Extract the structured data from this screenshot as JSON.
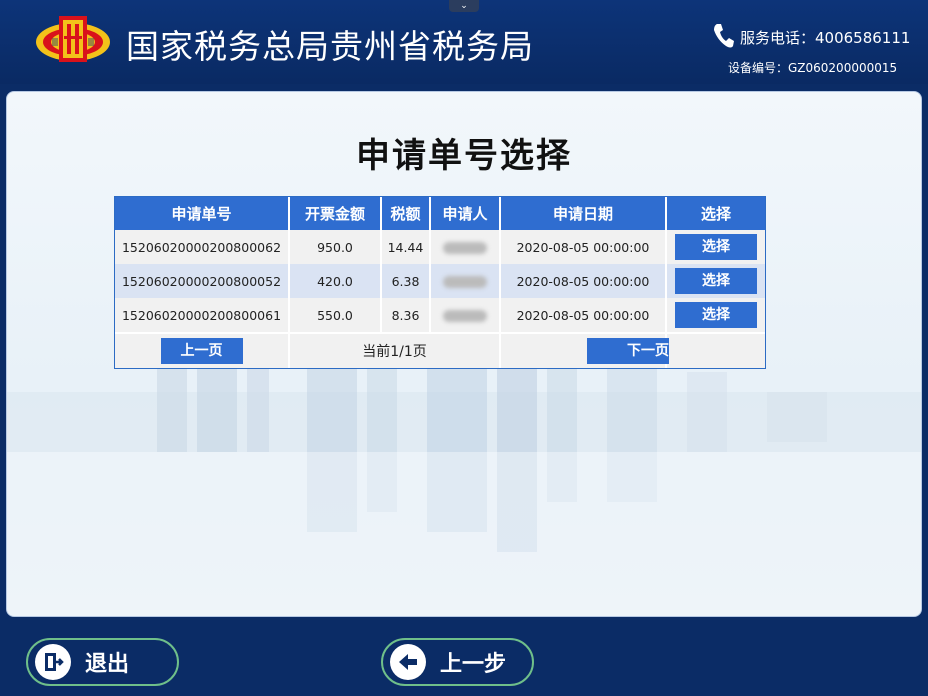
{
  "header": {
    "title": "国家税务总局贵州省税务局",
    "phone_text": "服务电话：4006586111",
    "device_text": "设备编号：GZ060200000015",
    "handle_glyph": "⌄"
  },
  "main": {
    "title": "申请单号选择",
    "columns": [
      "申请单号",
      "开票金额",
      "税额",
      "申请人",
      "申请日期",
      "选择"
    ],
    "rows": [
      {
        "number": "15206020000200800062",
        "amount": "950.0",
        "tax": "14.44",
        "date": "2020-08-05 00:00:00",
        "action": "选择"
      },
      {
        "number": "15206020000200800052",
        "amount": "420.0",
        "tax": "6.38",
        "date": "2020-08-05 00:00:00",
        "action": "选择"
      },
      {
        "number": "15206020000200800061",
        "amount": "550.0",
        "tax": "8.36",
        "date": "2020-08-05 00:00:00",
        "action": "选择"
      }
    ],
    "pager": {
      "prev": "上一页",
      "info": "当前1/1页",
      "next": "下一页"
    }
  },
  "footer": {
    "exit_label": "退出",
    "back_label": "上一步"
  },
  "colors": {
    "header_bg": "#0d3479",
    "accent": "#2f6dd0",
    "row_alt": "#dae3f3",
    "button_border": "#6fbf8a"
  },
  "icons": {
    "emblem": "tax-emblem-icon",
    "phone": "phone-icon",
    "exit": "exit-door-icon",
    "back": "arrow-left-icon"
  }
}
